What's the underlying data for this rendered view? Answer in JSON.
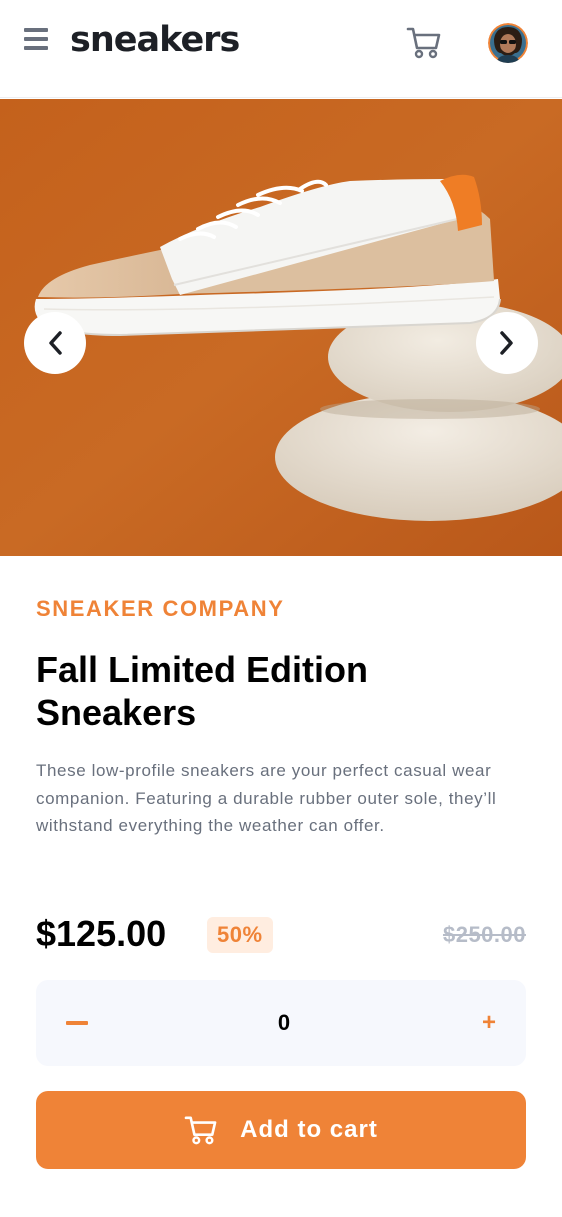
{
  "header": {
    "logo": "sneakers",
    "menu_icon": "hamburger-menu-icon",
    "cart_icon": "cart-icon",
    "avatar": "user-avatar"
  },
  "gallery": {
    "prev_icon": "chevron-left-icon",
    "next_icon": "chevron-right-icon"
  },
  "product": {
    "company": "SNEAKER COMPANY",
    "title": "Fall Limited Edition Sneakers",
    "description": "These low-profile sneakers are your perfect casual wear companion. Featuring a durable rubber outer sole, they’ll withstand everything the weather can offer.",
    "price": "$125.00",
    "discount": "50%",
    "old_price": "$250.00"
  },
  "quantity": {
    "minus_icon": "minus-icon",
    "value": "0",
    "plus_label": "+"
  },
  "cta": {
    "label": "Add to cart",
    "icon": "cart-icon"
  },
  "colors": {
    "accent": "#ef8337",
    "accent_pale": "#ffede0",
    "dark": "#1d2026",
    "grey": "#69707d",
    "light_grey": "#b6bcc8",
    "surface": "#f6f8fd"
  }
}
